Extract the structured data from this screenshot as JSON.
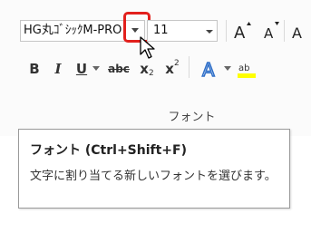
{
  "ribbon": {
    "font_name_value": "HG丸ｺﾞｼｯｸM-PRO",
    "font_size_value": "11",
    "grow_font_label": "A",
    "shrink_font_label": "A",
    "change_case_label": "A",
    "bold_label": "B",
    "italic_label": "I",
    "underline_label": "U",
    "strikethrough_label": "abc",
    "subscript_label": "x",
    "superscript_label": "x",
    "text_effects_label": "A",
    "highlight_label": "ab",
    "group_label": "フォント"
  },
  "tooltip": {
    "title": "フォント (Ctrl+Shift+F)",
    "description": "文字に割り当てる新しいフォントを選びます。"
  },
  "colors": {
    "highlight_box": "#e2201c",
    "text_highlight": "#ffff00",
    "text_effects": "#2f6fc8"
  }
}
